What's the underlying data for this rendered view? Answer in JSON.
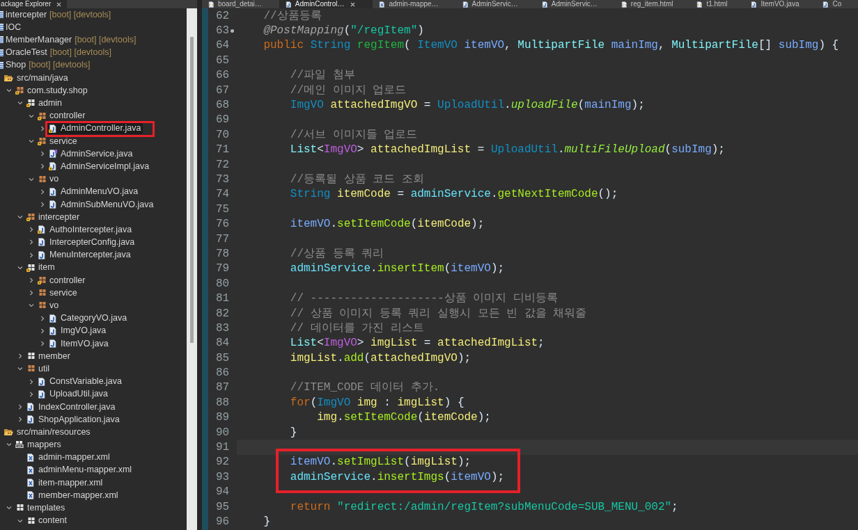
{
  "explorer": {
    "title": "ackage Explorer",
    "tree": [
      {
        "label": "intercepter",
        "decoration": "[boot] [devtools]",
        "kind": "project",
        "selected": false
      },
      {
        "label": "IOC",
        "kind": "project",
        "selected": false
      },
      {
        "label": "MemberManager",
        "decoration": "[boot] [devtools]",
        "kind": "project",
        "selected": false
      },
      {
        "label": "OracleTest",
        "decoration": "[boot] [devtools]",
        "kind": "project",
        "selected": false
      },
      {
        "label": "Shop",
        "decoration": "[boot] [devtools]",
        "kind": "project",
        "selected": false,
        "children": [
          {
            "label": "src/main/java",
            "kind": "source-folder",
            "selected": false,
            "children": [
              {
                "label": "com.study.shop",
                "kind": "package",
                "bean": true,
                "expanded": true,
                "selected": false,
                "children": [
                  {
                    "label": "admin",
                    "kind": "light-package",
                    "bean": true,
                    "expanded": true,
                    "selected": false,
                    "children": [
                      {
                        "label": "controller",
                        "kind": "package",
                        "bean": true,
                        "expanded": true,
                        "selected": false,
                        "children": [
                          {
                            "label": "AdminController.java",
                            "kind": "class",
                            "bean": true,
                            "expanded": false,
                            "selected": true,
                            "boxed": true
                          }
                        ]
                      },
                      {
                        "label": "service",
                        "kind": "package",
                        "bean": true,
                        "expanded": true,
                        "selected": false,
                        "children": [
                          {
                            "label": "AdminService.java",
                            "kind": "interface",
                            "bean": false,
                            "expanded": false,
                            "selected": false
                          },
                          {
                            "label": "AdminServiceImpl.java",
                            "kind": "class",
                            "bean": true,
                            "expanded": false,
                            "selected": false
                          }
                        ]
                      },
                      {
                        "label": "vo",
                        "kind": "package",
                        "bean": false,
                        "expanded": true,
                        "selected": false,
                        "children": [
                          {
                            "label": "AdminMenuVO.java",
                            "kind": "class",
                            "bean": false,
                            "expanded": false,
                            "selected": false
                          },
                          {
                            "label": "AdminSubMenuVO.java",
                            "kind": "class",
                            "bean": false,
                            "expanded": false,
                            "selected": false
                          }
                        ]
                      }
                    ]
                  },
                  {
                    "label": "intercepter",
                    "kind": "package",
                    "bean": true,
                    "expanded": true,
                    "selected": false,
                    "children": [
                      {
                        "label": "AuthoIntercepter.java",
                        "kind": "class",
                        "bean": true,
                        "expanded": false,
                        "selected": false
                      },
                      {
                        "label": "IntercepterConfig.java",
                        "kind": "class",
                        "bean": false,
                        "expanded": false,
                        "selected": false
                      },
                      {
                        "label": "MenuIntercepter.java",
                        "kind": "class",
                        "bean": false,
                        "expanded": false,
                        "selected": false
                      }
                    ]
                  },
                  {
                    "label": "item",
                    "kind": "light-package",
                    "bean": true,
                    "expanded": true,
                    "selected": false,
                    "children": [
                      {
                        "label": "controller",
                        "kind": "package",
                        "bean": true,
                        "expanded": false,
                        "selected": false
                      },
                      {
                        "label": "service",
                        "kind": "package",
                        "bean": false,
                        "expanded": false,
                        "selected": false
                      },
                      {
                        "label": "vo",
                        "kind": "package",
                        "bean": false,
                        "expanded": true,
                        "selected": false,
                        "children": [
                          {
                            "label": "CategoryVO.java",
                            "kind": "class",
                            "bean": false,
                            "expanded": false,
                            "selected": false
                          },
                          {
                            "label": "ImgVO.java",
                            "kind": "class",
                            "bean": false,
                            "expanded": false,
                            "selected": false
                          },
                          {
                            "label": "ItemVO.java",
                            "kind": "class",
                            "bean": false,
                            "expanded": false,
                            "selected": false
                          }
                        ]
                      }
                    ]
                  },
                  {
                    "label": "member",
                    "kind": "light-package",
                    "bean": false,
                    "expanded": false,
                    "selected": false
                  },
                  {
                    "label": "util",
                    "kind": "package",
                    "bean": false,
                    "expanded": true,
                    "selected": false,
                    "children": [
                      {
                        "label": "ConstVariable.java",
                        "kind": "class",
                        "bean": false,
                        "expanded": false,
                        "selected": false
                      },
                      {
                        "label": "UploadUtil.java",
                        "kind": "class",
                        "bean": false,
                        "expanded": false,
                        "selected": false
                      }
                    ]
                  },
                  {
                    "label": "IndexController.java",
                    "kind": "class",
                    "bean": false,
                    "expanded": false,
                    "selected": false
                  },
                  {
                    "label": "ShopApplication.java",
                    "kind": "class",
                    "bean": false,
                    "expanded": false,
                    "selected": false
                  }
                ]
              }
            ]
          },
          {
            "label": "src/main/resources",
            "kind": "source-folder",
            "selected": false,
            "children": [
              {
                "label": "mappers",
                "kind": "folder-package",
                "expanded": true,
                "selected": false,
                "children": [
                  {
                    "label": "admin-mapper.xml",
                    "kind": "xml",
                    "selected": false
                  },
                  {
                    "label": "adminMenu-mapper.xml",
                    "kind": "xml",
                    "selected": false
                  },
                  {
                    "label": "item-mapper.xml",
                    "kind": "xml",
                    "selected": false
                  },
                  {
                    "label": "member-mapper.xml",
                    "kind": "xml",
                    "selected": false
                  }
                ]
              },
              {
                "label": "templates",
                "kind": "light-package",
                "expanded": true,
                "selected": false,
                "children": [
                  {
                    "label": "content",
                    "kind": "light-package",
                    "expanded": true,
                    "selected": false
                  }
                ]
              }
            ]
          }
        ]
      }
    ]
  },
  "editor": {
    "tabs": [
      {
        "label": "board_detai…",
        "kind": "html",
        "selected": false
      },
      {
        "label": "AdminControl…",
        "kind": "java",
        "selected": true
      },
      {
        "label": "admin-mappe…",
        "kind": "xml",
        "selected": false
      },
      {
        "label": "AdminServic…",
        "kind": "java",
        "selected": false
      },
      {
        "label": "AdminServic…",
        "kind": "java",
        "selected": false
      },
      {
        "label": "reg_item.html",
        "kind": "html",
        "selected": false
      },
      {
        "label": "t1.html",
        "kind": "html",
        "selected": false
      },
      {
        "label": "ItemVO.java",
        "kind": "java",
        "selected": false
      },
      {
        "label": "Co",
        "kind": "java",
        "selected": false
      }
    ],
    "lines": [
      {
        "number": "62",
        "tokens": [
          {
            "kind": "comment",
            "text": "//상품등록"
          }
        ]
      },
      {
        "number": "63",
        "marker": true,
        "tokens": [
          {
            "kind": "annotation",
            "text": "@PostMapping"
          },
          {
            "kind": "plain",
            "text": "("
          },
          {
            "kind": "string",
            "text": "\"/regItem\""
          },
          {
            "kind": "plain",
            "text": ")"
          }
        ]
      },
      {
        "number": "64",
        "tokens": [
          {
            "kind": "keyword",
            "text": "public "
          },
          {
            "kind": "class",
            "text": "String "
          },
          {
            "kind": "method-declaration",
            "text": "regItem"
          },
          {
            "kind": "plain",
            "text": "( "
          },
          {
            "kind": "class",
            "text": "ItemVO "
          },
          {
            "kind": "parameter",
            "text": "itemVO"
          },
          {
            "kind": "plain",
            "text": ", "
          },
          {
            "kind": "interface",
            "text": "MultipartFile "
          },
          {
            "kind": "parameter",
            "text": "mainImg"
          },
          {
            "kind": "plain",
            "text": ", "
          },
          {
            "kind": "interface",
            "text": "MultipartFile"
          },
          {
            "kind": "plain",
            "text": "[] "
          },
          {
            "kind": "parameter",
            "text": "subImg"
          },
          {
            "kind": "plain",
            "text": ") {"
          }
        ],
        "children": [
          {
            "number": "65"
          },
          {
            "number": "66",
            "tokens": [
              {
                "kind": "comment",
                "text": "//파일 첨부"
              }
            ]
          },
          {
            "number": "67",
            "tokens": [
              {
                "kind": "comment",
                "text": "//메인 이미지 업로드"
              }
            ]
          },
          {
            "number": "68",
            "tokens": [
              {
                "kind": "class",
                "text": "ImgVO "
              },
              {
                "kind": "local",
                "text": "attachedImgVO"
              },
              {
                "kind": "plain",
                "text": " = "
              },
              {
                "kind": "class",
                "text": "UploadUtil"
              },
              {
                "kind": "plain",
                "text": "."
              },
              {
                "kind": "static-method",
                "text": "uploadFile"
              },
              {
                "kind": "plain",
                "text": "("
              },
              {
                "kind": "parameter",
                "text": "mainImg"
              },
              {
                "kind": "plain",
                "text": ");"
              }
            ]
          },
          {
            "number": "69"
          },
          {
            "number": "70",
            "tokens": [
              {
                "kind": "comment",
                "text": "//서브 이미지들 업로드"
              }
            ]
          },
          {
            "number": "71",
            "tokens": [
              {
                "kind": "interface",
                "text": "List"
              },
              {
                "kind": "plain",
                "text": "<"
              },
              {
                "kind": "type-argument",
                "text": "ImgVO"
              },
              {
                "kind": "plain",
                "text": "> "
              },
              {
                "kind": "local",
                "text": "attachedImgList"
              },
              {
                "kind": "plain",
                "text": " = "
              },
              {
                "kind": "class",
                "text": "UploadUtil"
              },
              {
                "kind": "plain",
                "text": "."
              },
              {
                "kind": "static-method",
                "text": "multiFileUpload"
              },
              {
                "kind": "plain",
                "text": "("
              },
              {
                "kind": "parameter",
                "text": "subImg"
              },
              {
                "kind": "plain",
                "text": ");"
              }
            ]
          },
          {
            "number": "72"
          },
          {
            "number": "73",
            "tokens": [
              {
                "kind": "comment",
                "text": "//등록될 상품 코드 조회"
              }
            ]
          },
          {
            "number": "74",
            "tokens": [
              {
                "kind": "class",
                "text": "String "
              },
              {
                "kind": "local",
                "text": "itemCode"
              },
              {
                "kind": "plain",
                "text": " = "
              },
              {
                "kind": "field",
                "text": "adminService"
              },
              {
                "kind": "plain",
                "text": "."
              },
              {
                "kind": "method",
                "text": "getNextItemCode"
              },
              {
                "kind": "plain",
                "text": "();"
              }
            ]
          },
          {
            "number": "75"
          },
          {
            "number": "76",
            "tokens": [
              {
                "kind": "parameter",
                "text": "itemVO"
              },
              {
                "kind": "plain",
                "text": "."
              },
              {
                "kind": "method",
                "text": "setItemCode"
              },
              {
                "kind": "plain",
                "text": "("
              },
              {
                "kind": "local",
                "text": "itemCode"
              },
              {
                "kind": "plain",
                "text": ");"
              }
            ]
          },
          {
            "number": "77"
          },
          {
            "number": "78",
            "tokens": [
              {
                "kind": "comment",
                "text": "//상품 등록 쿼리"
              }
            ]
          },
          {
            "number": "79",
            "tokens": [
              {
                "kind": "field",
                "text": "adminService"
              },
              {
                "kind": "plain",
                "text": "."
              },
              {
                "kind": "method",
                "text": "insertItem"
              },
              {
                "kind": "plain",
                "text": "("
              },
              {
                "kind": "parameter",
                "text": "itemVO"
              },
              {
                "kind": "plain",
                "text": ");"
              }
            ]
          },
          {
            "number": "80"
          },
          {
            "number": "81",
            "tokens": [
              {
                "kind": "comment",
                "text": "// --------------------상품 이미지 디비등록"
              }
            ]
          },
          {
            "number": "82",
            "tokens": [
              {
                "kind": "comment",
                "text": "// 상품 이미지 등록 쿼리 실행시 모든 빈 값을 채워줄"
              }
            ]
          },
          {
            "number": "83",
            "tokens": [
              {
                "kind": "comment",
                "text": "// 데이터를 가진 리스트"
              }
            ]
          },
          {
            "number": "84",
            "tokens": [
              {
                "kind": "interface",
                "text": "List"
              },
              {
                "kind": "plain",
                "text": "<"
              },
              {
                "kind": "type-argument",
                "text": "ImgVO"
              },
              {
                "kind": "plain",
                "text": "> "
              },
              {
                "kind": "local",
                "text": "imgList"
              },
              {
                "kind": "plain",
                "text": " = "
              },
              {
                "kind": "local",
                "text": "attachedImgList"
              },
              {
                "kind": "plain",
                "text": ";"
              }
            ]
          },
          {
            "number": "85",
            "tokens": [
              {
                "kind": "local",
                "text": "imgList"
              },
              {
                "kind": "plain",
                "text": "."
              },
              {
                "kind": "method",
                "text": "add"
              },
              {
                "kind": "plain",
                "text": "("
              },
              {
                "kind": "local",
                "text": "attachedImgVO"
              },
              {
                "kind": "plain",
                "text": ");"
              }
            ]
          },
          {
            "number": "86"
          },
          {
            "number": "87",
            "tokens": [
              {
                "kind": "comment",
                "text": "//ITEM_CODE 데이터 추가."
              }
            ]
          },
          {
            "number": "88",
            "tokens": [
              {
                "kind": "keyword",
                "text": "for"
              },
              {
                "kind": "plain",
                "text": "("
              },
              {
                "kind": "class",
                "text": "ImgVO "
              },
              {
                "kind": "local",
                "text": "img"
              },
              {
                "kind": "plain",
                "text": " : "
              },
              {
                "kind": "local",
                "text": "imgList"
              },
              {
                "kind": "plain",
                "text": ") {"
              }
            ],
            "children": [
              {
                "number": "89",
                "tokens": [
                  {
                    "kind": "local",
                    "text": "img"
                  },
                  {
                    "kind": "plain",
                    "text": "."
                  },
                  {
                    "kind": "method",
                    "text": "setItemCode"
                  },
                  {
                    "kind": "plain",
                    "text": "("
                  },
                  {
                    "kind": "local",
                    "text": "itemCode"
                  },
                  {
                    "kind": "plain",
                    "text": ");"
                  }
                ]
              }
            ]
          },
          {
            "number": "90",
            "tokens": [
              {
                "kind": "plain",
                "text": "}"
              }
            ]
          },
          {
            "number": "91",
            "current": true
          },
          {
            "number": "92",
            "boxed": true,
            "tokens": [
              {
                "kind": "parameter",
                "text": "itemVO"
              },
              {
                "kind": "plain",
                "text": "."
              },
              {
                "kind": "method",
                "text": "setImgList"
              },
              {
                "kind": "plain",
                "text": "("
              },
              {
                "kind": "local",
                "text": "imgList"
              },
              {
                "kind": "plain",
                "text": ");"
              }
            ]
          },
          {
            "number": "93",
            "boxed": true,
            "tokens": [
              {
                "kind": "field",
                "text": "adminService"
              },
              {
                "kind": "plain",
                "text": "."
              },
              {
                "kind": "method",
                "text": "insertImgs"
              },
              {
                "kind": "plain",
                "text": "("
              },
              {
                "kind": "parameter",
                "text": "itemVO"
              },
              {
                "kind": "plain",
                "text": ");"
              }
            ]
          },
          {
            "number": "94"
          },
          {
            "number": "95",
            "tokens": [
              {
                "kind": "keyword",
                "text": "return "
              },
              {
                "kind": "string",
                "text": "\"redirect:/admin/regItem?subMenuCode=SUB_MENU_002\""
              },
              {
                "kind": "plain",
                "text": ";"
              }
            ]
          }
        ]
      },
      {
        "number": "96",
        "tokens": [
          {
            "kind": "plain",
            "text": "}"
          }
        ]
      }
    ]
  }
}
